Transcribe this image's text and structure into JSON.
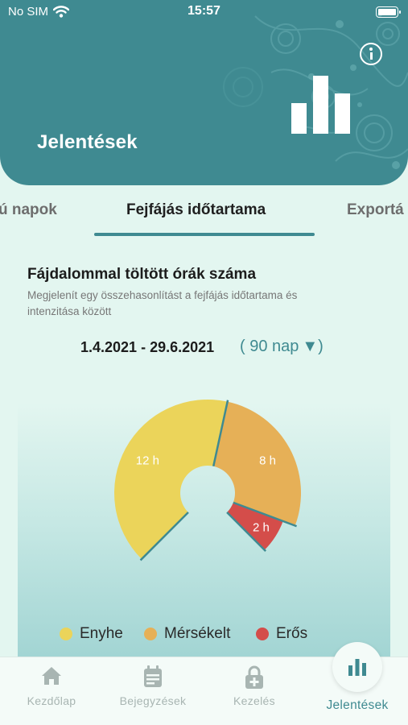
{
  "status_bar": {
    "carrier": "No SIM",
    "time": "15:57"
  },
  "header": {
    "title": "Jelentések"
  },
  "tabs": [
    {
      "label": "ú napok"
    },
    {
      "label": "Fejfájás időtartama"
    },
    {
      "label": "Exportá"
    }
  ],
  "section": {
    "title": "Fájdalommal töltött órák száma",
    "description": "Megjelenít egy összehasonlítást a fejfájás időtartama és intenzitása között"
  },
  "date_range": "1.4.2021 - 29.6.2021",
  "period": {
    "selected": "( 90 nap",
    "arrow": "▼)"
  },
  "chart_data": {
    "type": "pie",
    "variant": "donut",
    "categories": [
      "Enyhe",
      "Mérsékelt",
      "Erős"
    ],
    "values": [
      12,
      8,
      2
    ],
    "labels": [
      "12 h",
      "8 h",
      "2 h"
    ],
    "colors": [
      "#ebd45a",
      "#e6b057",
      "#d44d4a"
    ]
  },
  "legend": [
    {
      "label": "Enyhe",
      "color": "#ebd45a"
    },
    {
      "label": "Mérsékelt",
      "color": "#e6b057"
    },
    {
      "label": "Erős",
      "color": "#d44d4a"
    }
  ],
  "bottom_nav": [
    {
      "label": "Kezdőlap",
      "icon": "home-icon"
    },
    {
      "label": "Bejegyzések",
      "icon": "calendar-icon"
    },
    {
      "label": "Kezelés",
      "icon": "lock-plus-icon"
    },
    {
      "label": "Jelentések",
      "icon": "bar-chart-icon"
    }
  ],
  "colors": {
    "accent": "#3f8a91",
    "background": "#e3f6f0"
  }
}
